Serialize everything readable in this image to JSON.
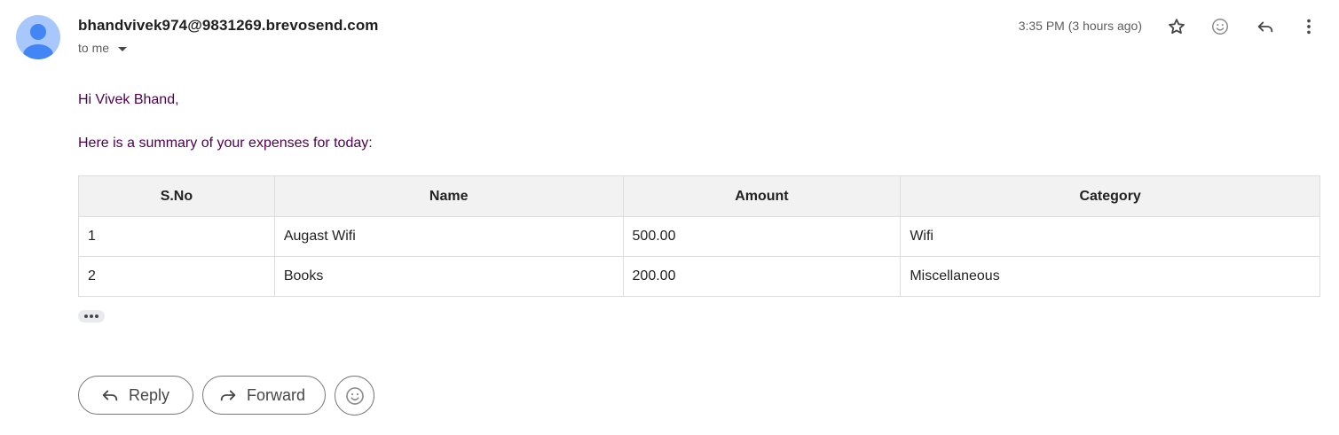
{
  "header": {
    "sender": "bhandvivek974@9831269.brevosend.com",
    "recipient_label": "to me",
    "timestamp": "3:35 PM (3 hours ago)",
    "icons": [
      "star-icon",
      "emoji-react-icon",
      "reply-icon",
      "more-vert-icon"
    ]
  },
  "message": {
    "greeting": "Hi Vivek Bhand,",
    "intro": "Here is a summary of your expenses for today:",
    "table": {
      "headers": [
        "S.No",
        "Name",
        "Amount",
        "Category"
      ],
      "rows": [
        [
          "1",
          "Augast Wifi",
          "500.00",
          "Wifi"
        ],
        [
          "2",
          "Books",
          "200.00",
          "Miscellaneous"
        ]
      ]
    }
  },
  "actions": {
    "reply_label": "Reply",
    "forward_label": "Forward"
  },
  "colors": {
    "body_text": "#500050",
    "table_header_bg": "#f2f2f2",
    "avatar_bg": "#a8c7fa",
    "avatar_fg": "#4285f4"
  }
}
